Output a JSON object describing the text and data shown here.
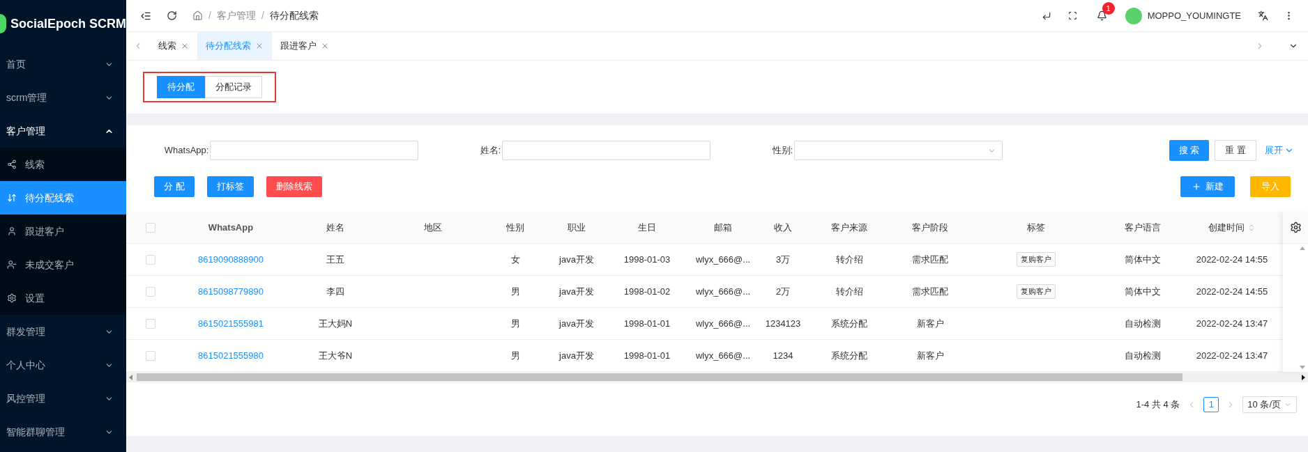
{
  "sidebar": {
    "logo": "SocialEpoch SCRM",
    "items": [
      {
        "label": "首页",
        "expanded": false
      },
      {
        "label": "scrm管理",
        "expanded": false
      },
      {
        "label": "客户管理",
        "expanded": true,
        "children": [
          {
            "label": "线索",
            "selected": false
          },
          {
            "label": "待分配线索",
            "selected": true
          },
          {
            "label": "跟进客户",
            "selected": false
          },
          {
            "label": "未成交客户",
            "selected": false
          },
          {
            "label": "设置",
            "selected": false
          }
        ]
      },
      {
        "label": "群发管理",
        "expanded": false
      },
      {
        "label": "个人中心",
        "expanded": false
      },
      {
        "label": "风控管理",
        "expanded": false
      },
      {
        "label": "智能群聊管理",
        "expanded": false
      }
    ]
  },
  "header": {
    "breadcrumb": [
      "客户管理",
      "待分配线索"
    ],
    "separator": "/",
    "notification_count": "1",
    "user": "MOPPO_YOUMINGTE"
  },
  "tabs": [
    {
      "label": "线索",
      "selected": false
    },
    {
      "label": "待分配线索",
      "selected": true
    },
    {
      "label": "跟进客户",
      "selected": false
    }
  ],
  "segments": [
    {
      "label": "待分配",
      "selected": true
    },
    {
      "label": "分配记录",
      "selected": false
    }
  ],
  "filters": [
    {
      "label": "WhatsApp:",
      "kind": "text"
    },
    {
      "label": "姓名:",
      "kind": "text"
    },
    {
      "label": "性别:",
      "kind": "select"
    }
  ],
  "filter_buttons": {
    "search": "搜 索",
    "reset": "重 置",
    "expand": "展开"
  },
  "actions_left": [
    {
      "label": "分 配",
      "kind": "primary"
    },
    {
      "label": "打标签",
      "kind": "primary"
    },
    {
      "label": "删除线索",
      "kind": "danger"
    }
  ],
  "actions_right": [
    {
      "label": "新建",
      "kind": "primary"
    },
    {
      "label": "导入",
      "kind": "warning"
    }
  ],
  "table": {
    "all_checked": false,
    "columns": [
      {
        "label": "WhatsApp",
        "sortable": false
      },
      {
        "label": "姓名",
        "sortable": false
      },
      {
        "label": "地区",
        "sortable": false
      },
      {
        "label": "性别",
        "sortable": false
      },
      {
        "label": "职业",
        "sortable": false
      },
      {
        "label": "生日",
        "sortable": false
      },
      {
        "label": "邮箱",
        "sortable": false
      },
      {
        "label": "收入",
        "sortable": false
      },
      {
        "label": "客户来源",
        "sortable": false
      },
      {
        "label": "客户阶段",
        "sortable": false
      },
      {
        "label": "标签",
        "sortable": false
      },
      {
        "label": "客户语言",
        "sortable": false
      },
      {
        "label": "创建时间",
        "sortable": true
      }
    ],
    "rows": [
      {
        "checked": false,
        "cells": [
          "8619090888900",
          "王五",
          "",
          "女",
          "java开发",
          "1998-01-03",
          "wlyx_666@...",
          "3万",
          "转介绍",
          "需求匹配",
          "复购客户",
          "简体中文",
          "2022-02-24 14:55"
        ]
      },
      {
        "checked": false,
        "cells": [
          "8615098779890",
          "李四",
          "",
          "男",
          "java开发",
          "1998-01-02",
          "wlyx_666@...",
          "2万",
          "转介绍",
          "需求匹配",
          "复购客户",
          "简体中文",
          "2022-02-24 14:55"
        ]
      },
      {
        "checked": false,
        "cells": [
          "8615021555981",
          "王大妈N",
          "",
          "男",
          "java开发",
          "1998-01-01",
          "wlyx_666@...",
          "1234123",
          "系统分配",
          "新客户",
          "",
          "自动检测",
          "2022-02-24 13:47"
        ]
      },
      {
        "checked": false,
        "cells": [
          "8615021555980",
          "王大爷N",
          "",
          "男",
          "java开发",
          "1998-01-01",
          "wlyx_666@...",
          "1234",
          "系统分配",
          "新客户",
          "",
          "自动检测",
          "2022-02-24 13:47"
        ]
      }
    ]
  },
  "pagination": {
    "summary": "1-4 共 4 条",
    "page": "1",
    "page_size": "10 条/页"
  }
}
